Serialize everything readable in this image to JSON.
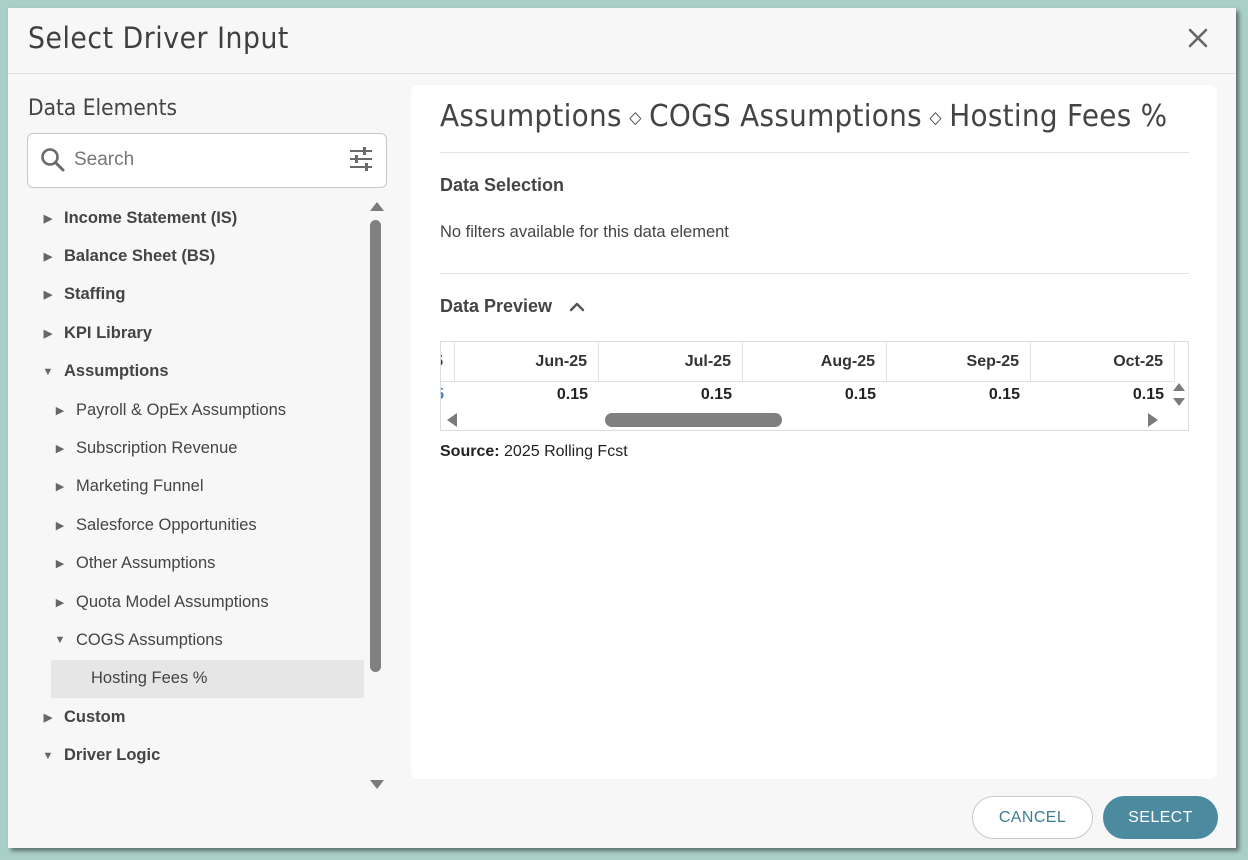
{
  "dialog": {
    "title": "Select Driver Input"
  },
  "left": {
    "heading": "Data Elements",
    "search_placeholder": "Search",
    "tree": [
      {
        "label": "Income Statement (IS)",
        "level": 0,
        "bold": true,
        "expanded": false
      },
      {
        "label": "Balance Sheet (BS)",
        "level": 0,
        "bold": true,
        "expanded": false
      },
      {
        "label": "Staffing",
        "level": 0,
        "bold": true,
        "expanded": false
      },
      {
        "label": "KPI Library",
        "level": 0,
        "bold": true,
        "expanded": false
      },
      {
        "label": "Assumptions",
        "level": 0,
        "bold": true,
        "expanded": true
      },
      {
        "label": "Payroll & OpEx Assumptions",
        "level": 1,
        "bold": false,
        "expanded": false
      },
      {
        "label": "Subscription Revenue",
        "level": 1,
        "bold": false,
        "expanded": false
      },
      {
        "label": "Marketing Funnel",
        "level": 1,
        "bold": false,
        "expanded": false
      },
      {
        "label": "Salesforce Opportunities",
        "level": 1,
        "bold": false,
        "expanded": false
      },
      {
        "label": "Other Assumptions",
        "level": 1,
        "bold": false,
        "expanded": false
      },
      {
        "label": "Quota Model Assumptions",
        "level": 1,
        "bold": false,
        "expanded": false
      },
      {
        "label": "COGS Assumptions",
        "level": 1,
        "bold": false,
        "expanded": true
      },
      {
        "label": "Hosting Fees %",
        "level": 2,
        "bold": false,
        "leaf": true,
        "selected": true
      },
      {
        "label": "Custom",
        "level": 0,
        "bold": true,
        "expanded": false
      },
      {
        "label": "Driver Logic",
        "level": 0,
        "bold": true,
        "expanded": true
      }
    ]
  },
  "right": {
    "breadcrumb": [
      "Assumptions",
      "COGS Assumptions",
      "Hosting Fees %"
    ],
    "breadcrumb_separator": "◇",
    "data_selection_title": "Data Selection",
    "no_filters_text": "No filters available for this data element",
    "data_preview_title": "Data Preview",
    "grid": {
      "partial_header": "5",
      "partial_value": "5",
      "columns": [
        "Jun-25",
        "Jul-25",
        "Aug-25",
        "Sep-25",
        "Oct-25"
      ],
      "values": [
        "0.15",
        "0.15",
        "0.15",
        "0.15",
        "0.15"
      ]
    },
    "source_label": "Source:",
    "source_value": "2025 Rolling Fcst"
  },
  "footer": {
    "cancel_label": "CANCEL",
    "select_label": "SELECT"
  },
  "colors": {
    "accent": "#4c8aa0",
    "background": "#a9cfc6"
  }
}
